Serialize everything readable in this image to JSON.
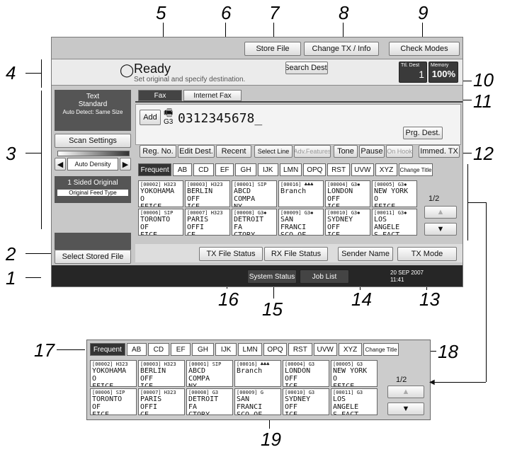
{
  "callouts": [
    "1",
    "2",
    "3",
    "4",
    "5",
    "6",
    "7",
    "8",
    "9",
    "10",
    "11",
    "12",
    "13",
    "14",
    "15",
    "16",
    "17",
    "18",
    "19"
  ],
  "top_buttons": {
    "store_file": "Store File",
    "change_tx_info": "Change TX / Info",
    "check_modes": "Check Modes"
  },
  "status": {
    "ready": "Ready",
    "message": "Set original and specify destination.",
    "search_dest": "Search Dest.",
    "ttl_dest_label": "Ttl. Dest",
    "ttl_dest_value": "1",
    "memory_label": "Memory",
    "memory_value": "100%"
  },
  "tabs": {
    "fax": "Fax",
    "internet_fax": "Internet Fax"
  },
  "left_panel": {
    "text_mode": "Text",
    "resolution": "Standard",
    "auto_detect": "Auto Detect: Same Size",
    "scan_settings": "Scan Settings",
    "auto_density": "Auto Density",
    "sided_original": "1 Sided Original",
    "original_feed_type": "Original Feed Type",
    "select_stored_file": "Select Stored File"
  },
  "dest": {
    "add": "Add",
    "g3": "G3",
    "number": "0312345678_",
    "prg_dest": "Prg. Dest."
  },
  "dest_buttons": [
    "Reg. No.",
    "Edit Dest.",
    "Recent",
    "Select Line",
    "Adv.Features",
    "Tone",
    "Pause",
    "On Hook",
    "Immed. TX"
  ],
  "title_tabs": [
    "Frequent",
    "AB",
    "CD",
    "EF",
    "GH",
    "IJK",
    "LMN",
    "OPQ",
    "RST",
    "UVW",
    "XYZ",
    "Change Title"
  ],
  "entries": [
    {
      "head": "[00002] H323",
      "l1": "YOKOHAMA O",
      "l2": "FFICE"
    },
    {
      "head": "[00003] H323",
      "l1": "BERLIN OFF",
      "l2": "ICE"
    },
    {
      "head": "[00001] SIP",
      "l1": "ABCD COMPA",
      "l2": "NY"
    },
    {
      "head": "[00016] ♣♣♣",
      "l1": "Branch",
      "l2": ""
    },
    {
      "head": "[00004] G3✱",
      "l1": "LONDON OFF",
      "l2": "ICE"
    },
    {
      "head": "[00005] G3✱",
      "l1": "NEW YORK O",
      "l2": "FFICE"
    },
    {
      "head": "[00006] SIP",
      "l1": "TORONTO OF",
      "l2": "FICE"
    },
    {
      "head": "[00007] H323",
      "l1": "PARIS OFFI",
      "l2": "CE"
    },
    {
      "head": "[00008] G3✱",
      "l1": "DETROIT FA",
      "l2": "CTORY"
    },
    {
      "head": "[00009] G3✱",
      "l1": "SAN FRANCI",
      "l2": "SCO OF"
    },
    {
      "head": "[00010] G3✱",
      "l1": "SYDNEY OFF",
      "l2": "ICE"
    },
    {
      "head": "[00011] G3✱",
      "l1": "LOS ANGELE",
      "l2": "S FACT"
    }
  ],
  "entries_zoom": [
    {
      "head": "[00002] H323",
      "l1": "YOKOHAMA O",
      "l2": "FFICE"
    },
    {
      "head": "[00003] H323",
      "l1": "BERLIN OFF",
      "l2": "ICE"
    },
    {
      "head": "[00001] SIP",
      "l1": "ABCD COMPA",
      "l2": "NY"
    },
    {
      "head": "[00016] ♣♣♣",
      "l1": "Branch",
      "l2": ""
    },
    {
      "head": "[00004] G3",
      "l1": "LONDON OFF",
      "l2": "ICE"
    },
    {
      "head": "[00005] G3",
      "l1": "NEW YORK O",
      "l2": "FFICE"
    },
    {
      "head": "[00006] SIP",
      "l1": "TORONTO OF",
      "l2": "FICE"
    },
    {
      "head": "[00007] H323",
      "l1": "PARIS OFFI",
      "l2": "CE"
    },
    {
      "head": "[00008] G3",
      "l1": "DETROIT FA",
      "l2": "CTORY"
    },
    {
      "head": "[00009] G",
      "l1": "SAN FRANCI",
      "l2": "SCO OF"
    },
    {
      "head": "[00010] G3",
      "l1": "SYDNEY OFF",
      "l2": "ICE"
    },
    {
      "head": "[00011] G3",
      "l1": "LOS ANGELE",
      "l2": "S FACT"
    }
  ],
  "page": "1/2",
  "bottom": {
    "tx_file_status": "TX File Status",
    "rx_file_status": "RX File Status",
    "sender_name": "Sender Name",
    "tx_mode": "TX Mode",
    "system_status": "System Status",
    "job_list": "Job List",
    "date": "20 SEP 2007",
    "time": "11:41"
  }
}
